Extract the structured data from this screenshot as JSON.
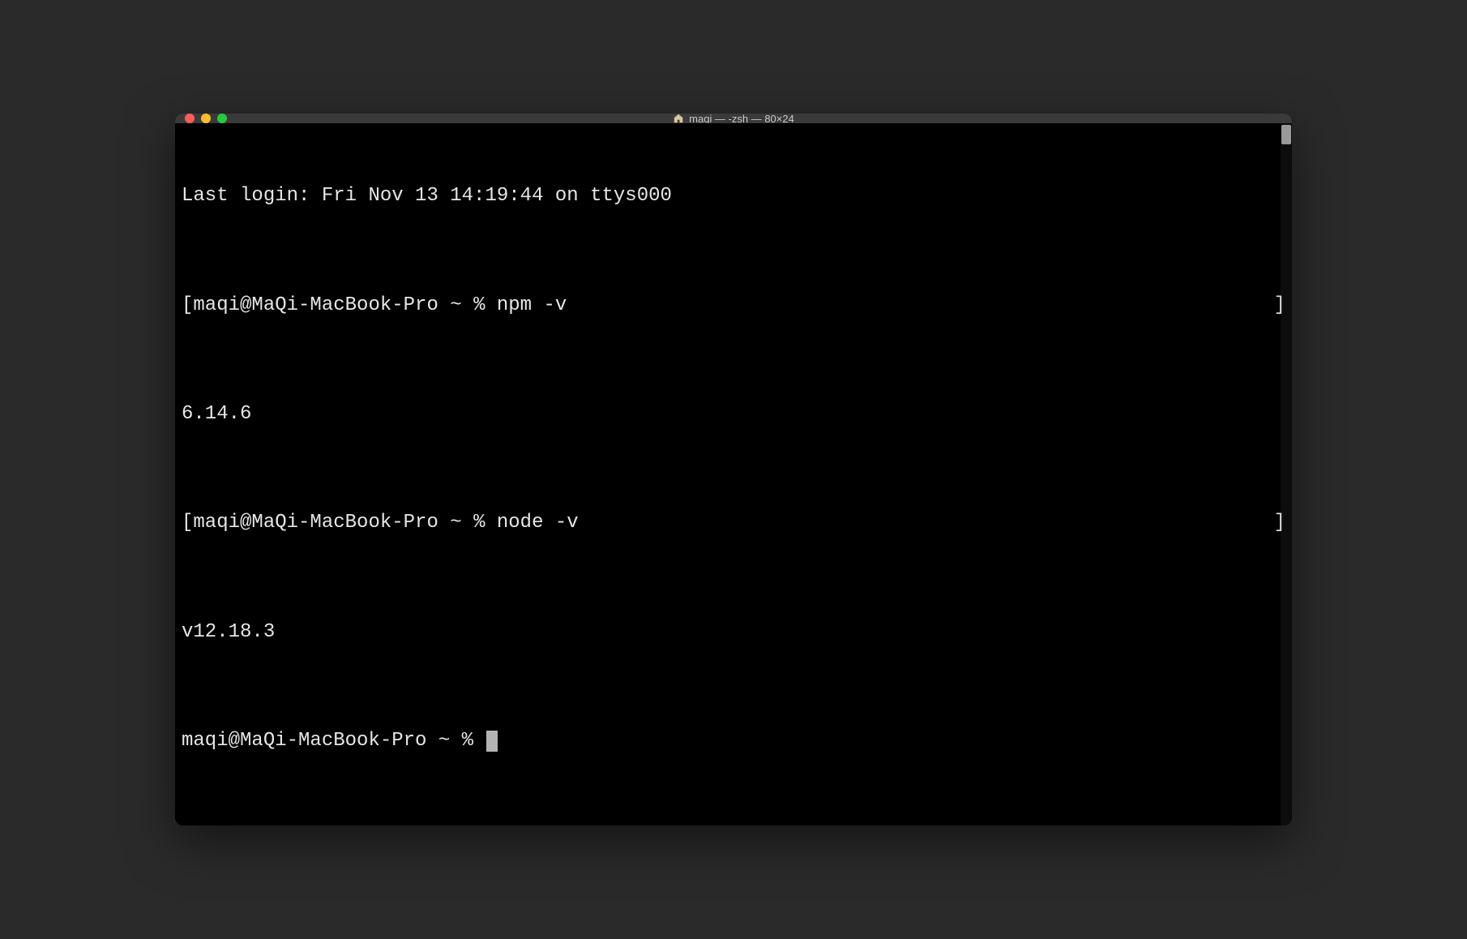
{
  "window": {
    "title": "maqi — -zsh — 80×24"
  },
  "terminal": {
    "last_login": "Last login: Fri Nov 13 14:19:44 on ttys000",
    "lines": [
      {
        "open_bracket": "[",
        "prompt": "maqi@MaQi-MacBook-Pro ~ % ",
        "cmd": "npm -v",
        "close_bracket": "]"
      },
      {
        "output": "6.14.6"
      },
      {
        "open_bracket": "[",
        "prompt": "maqi@MaQi-MacBook-Pro ~ % ",
        "cmd": "node -v",
        "close_bracket": "]"
      },
      {
        "output": "v12.18.3"
      },
      {
        "prompt": "maqi@MaQi-MacBook-Pro ~ % ",
        "cursor": true
      }
    ]
  }
}
